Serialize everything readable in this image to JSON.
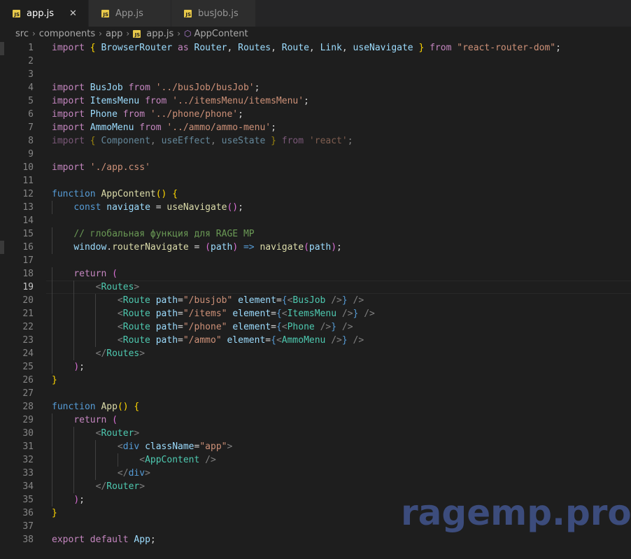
{
  "tabs": [
    {
      "label": "app.js",
      "icon": "js-file-icon",
      "active": true
    },
    {
      "label": "App.js",
      "icon": "js-file-icon",
      "active": false
    },
    {
      "label": "busJob.js",
      "icon": "js-file-icon",
      "active": false
    }
  ],
  "breadcrumb": [
    "src",
    "components",
    "app",
    "app.js",
    "AppContent"
  ],
  "current_line": 19,
  "code_lines": [
    {
      "n": 1,
      "t": [
        [
          "kw",
          "import"
        ],
        [
          "txt",
          " "
        ],
        [
          "br1",
          "{"
        ],
        [
          "vr",
          " BrowserRouter "
        ],
        [
          "kw",
          "as"
        ],
        [
          "vr",
          " Router"
        ],
        [
          "txt",
          ", "
        ],
        [
          "vr",
          "Routes"
        ],
        [
          "txt",
          ", "
        ],
        [
          "vr",
          "Route"
        ],
        [
          "txt",
          ", "
        ],
        [
          "vr",
          "Link"
        ],
        [
          "txt",
          ", "
        ],
        [
          "vr",
          "useNavigate"
        ],
        [
          "txt",
          " "
        ],
        [
          "br1",
          "}"
        ],
        [
          "txt",
          " "
        ],
        [
          "kw",
          "from"
        ],
        [
          "txt",
          " "
        ],
        [
          "sr",
          "\"react-router-dom\""
        ],
        [
          "txt",
          ";"
        ]
      ]
    },
    {
      "n": 2,
      "t": []
    },
    {
      "n": 3,
      "t": []
    },
    {
      "n": 4,
      "t": [
        [
          "kw",
          "import"
        ],
        [
          "vr",
          " BusJob "
        ],
        [
          "kw",
          "from"
        ],
        [
          "txt",
          " "
        ],
        [
          "sr",
          "'../busJob/busJob'"
        ],
        [
          "txt",
          ";"
        ]
      ]
    },
    {
      "n": 5,
      "t": [
        [
          "kw",
          "import"
        ],
        [
          "vr",
          " ItemsMenu "
        ],
        [
          "kw",
          "from"
        ],
        [
          "txt",
          " "
        ],
        [
          "sr",
          "'../itemsMenu/itemsMenu'"
        ],
        [
          "txt",
          ";"
        ]
      ]
    },
    {
      "n": 6,
      "t": [
        [
          "kw",
          "import"
        ],
        [
          "vr",
          " Phone "
        ],
        [
          "kw",
          "from"
        ],
        [
          "txt",
          " "
        ],
        [
          "sr",
          "'../phone/phone'"
        ],
        [
          "txt",
          ";"
        ]
      ]
    },
    {
      "n": 7,
      "t": [
        [
          "kw",
          "import"
        ],
        [
          "vr",
          " AmmoMenu "
        ],
        [
          "kw",
          "from"
        ],
        [
          "txt",
          " "
        ],
        [
          "sr",
          "'../ammo/ammo-menu'"
        ],
        [
          "txt",
          ";"
        ]
      ]
    },
    {
      "n": 8,
      "dim": true,
      "t": [
        [
          "kw",
          "import"
        ],
        [
          "txt",
          " "
        ],
        [
          "br1",
          "{"
        ],
        [
          "vr",
          " Component"
        ],
        [
          "txt",
          ", "
        ],
        [
          "vr",
          "useEffect"
        ],
        [
          "txt",
          ", "
        ],
        [
          "vr",
          "useState"
        ],
        [
          "txt",
          " "
        ],
        [
          "br1",
          "}"
        ],
        [
          "txt",
          " "
        ],
        [
          "kw",
          "from"
        ],
        [
          "txt",
          " "
        ],
        [
          "sr",
          "'react'"
        ],
        [
          "txt",
          ";"
        ]
      ]
    },
    {
      "n": 9,
      "t": []
    },
    {
      "n": 10,
      "t": [
        [
          "kw",
          "import"
        ],
        [
          "txt",
          " "
        ],
        [
          "sr",
          "'./app.css'"
        ]
      ]
    },
    {
      "n": 11,
      "t": []
    },
    {
      "n": 12,
      "t": [
        [
          "st",
          "function"
        ],
        [
          "txt",
          " "
        ],
        [
          "fn",
          "AppContent"
        ],
        [
          "br1",
          "()"
        ],
        [
          "txt",
          " "
        ],
        [
          "br1",
          "{"
        ]
      ]
    },
    {
      "n": 13,
      "t": [
        [
          "txt",
          "    "
        ],
        [
          "st",
          "const"
        ],
        [
          "txt",
          " "
        ],
        [
          "vr",
          "navigate"
        ],
        [
          "txt",
          " = "
        ],
        [
          "fn",
          "useNavigate"
        ],
        [
          "br2",
          "()"
        ],
        [
          "txt",
          ";"
        ]
      ]
    },
    {
      "n": 14,
      "t": []
    },
    {
      "n": 15,
      "t": [
        [
          "txt",
          "    "
        ],
        [
          "cm",
          "// глобальная функция для RAGE MP"
        ]
      ]
    },
    {
      "n": 16,
      "t": [
        [
          "txt",
          "    "
        ],
        [
          "vr",
          "window"
        ],
        [
          "txt",
          "."
        ],
        [
          "fn",
          "routerNavigate"
        ],
        [
          "txt",
          " = "
        ],
        [
          "br2",
          "("
        ],
        [
          "vr",
          "path"
        ],
        [
          "br2",
          ")"
        ],
        [
          "txt",
          " "
        ],
        [
          "st",
          "=>"
        ],
        [
          "txt",
          " "
        ],
        [
          "fn",
          "navigate"
        ],
        [
          "br2",
          "("
        ],
        [
          "vr",
          "path"
        ],
        [
          "br2",
          ")"
        ],
        [
          "txt",
          ";"
        ]
      ]
    },
    {
      "n": 17,
      "t": []
    },
    {
      "n": 18,
      "t": [
        [
          "txt",
          "    "
        ],
        [
          "kw",
          "return"
        ],
        [
          "txt",
          " "
        ],
        [
          "br2",
          "("
        ]
      ]
    },
    {
      "n": 19,
      "t": [
        [
          "txt",
          "        "
        ],
        [
          "pu",
          "<"
        ],
        [
          "tg",
          "Routes"
        ],
        [
          "pu",
          ">"
        ]
      ]
    },
    {
      "n": 20,
      "t": [
        [
          "txt",
          "            "
        ],
        [
          "pu",
          "<"
        ],
        [
          "tg",
          "Route"
        ],
        [
          "txt",
          " "
        ],
        [
          "at",
          "path"
        ],
        [
          "txt",
          "="
        ],
        [
          "sr",
          "\"/busjob\""
        ],
        [
          "txt",
          " "
        ],
        [
          "at",
          "element"
        ],
        [
          "txt",
          "="
        ],
        [
          "st",
          "{"
        ],
        [
          "pu",
          "<"
        ],
        [
          "tg",
          "BusJob"
        ],
        [
          "txt",
          " "
        ],
        [
          "pu",
          "/>"
        ],
        [
          "st",
          "}"
        ],
        [
          "txt",
          " "
        ],
        [
          "pu",
          "/>"
        ]
      ]
    },
    {
      "n": 21,
      "t": [
        [
          "txt",
          "            "
        ],
        [
          "pu",
          "<"
        ],
        [
          "tg",
          "Route"
        ],
        [
          "txt",
          " "
        ],
        [
          "at",
          "path"
        ],
        [
          "txt",
          "="
        ],
        [
          "sr",
          "\"/items\""
        ],
        [
          "txt",
          " "
        ],
        [
          "at",
          "element"
        ],
        [
          "txt",
          "="
        ],
        [
          "st",
          "{"
        ],
        [
          "pu",
          "<"
        ],
        [
          "tg",
          "ItemsMenu"
        ],
        [
          "txt",
          " "
        ],
        [
          "pu",
          "/>"
        ],
        [
          "st",
          "}"
        ],
        [
          "txt",
          " "
        ],
        [
          "pu",
          "/>"
        ]
      ]
    },
    {
      "n": 22,
      "t": [
        [
          "txt",
          "            "
        ],
        [
          "pu",
          "<"
        ],
        [
          "tg",
          "Route"
        ],
        [
          "txt",
          " "
        ],
        [
          "at",
          "path"
        ],
        [
          "txt",
          "="
        ],
        [
          "sr",
          "\"/phone\""
        ],
        [
          "txt",
          " "
        ],
        [
          "at",
          "element"
        ],
        [
          "txt",
          "="
        ],
        [
          "st",
          "{"
        ],
        [
          "pu",
          "<"
        ],
        [
          "tg",
          "Phone"
        ],
        [
          "txt",
          " "
        ],
        [
          "pu",
          "/>"
        ],
        [
          "st",
          "}"
        ],
        [
          "txt",
          " "
        ],
        [
          "pu",
          "/>"
        ]
      ]
    },
    {
      "n": 23,
      "t": [
        [
          "txt",
          "            "
        ],
        [
          "pu",
          "<"
        ],
        [
          "tg",
          "Route"
        ],
        [
          "txt",
          " "
        ],
        [
          "at",
          "path"
        ],
        [
          "txt",
          "="
        ],
        [
          "sr",
          "\"/ammo\""
        ],
        [
          "txt",
          " "
        ],
        [
          "at",
          "element"
        ],
        [
          "txt",
          "="
        ],
        [
          "st",
          "{"
        ],
        [
          "pu",
          "<"
        ],
        [
          "tg",
          "AmmoMenu"
        ],
        [
          "txt",
          " "
        ],
        [
          "pu",
          "/>"
        ],
        [
          "st",
          "}"
        ],
        [
          "txt",
          " "
        ],
        [
          "pu",
          "/>"
        ]
      ]
    },
    {
      "n": 24,
      "t": [
        [
          "txt",
          "        "
        ],
        [
          "pu",
          "</"
        ],
        [
          "tg",
          "Routes"
        ],
        [
          "pu",
          ">"
        ]
      ]
    },
    {
      "n": 25,
      "t": [
        [
          "txt",
          "    "
        ],
        [
          "br2",
          ")"
        ],
        [
          "txt",
          ";"
        ]
      ]
    },
    {
      "n": 26,
      "t": [
        [
          "br1",
          "}"
        ]
      ]
    },
    {
      "n": 27,
      "t": []
    },
    {
      "n": 28,
      "t": [
        [
          "st",
          "function"
        ],
        [
          "txt",
          " "
        ],
        [
          "fn",
          "App"
        ],
        [
          "br1",
          "()"
        ],
        [
          "txt",
          " "
        ],
        [
          "br1",
          "{"
        ]
      ]
    },
    {
      "n": 29,
      "t": [
        [
          "txt",
          "    "
        ],
        [
          "kw",
          "return"
        ],
        [
          "txt",
          " "
        ],
        [
          "br2",
          "("
        ]
      ]
    },
    {
      "n": 30,
      "t": [
        [
          "txt",
          "        "
        ],
        [
          "pu",
          "<"
        ],
        [
          "tg",
          "Router"
        ],
        [
          "pu",
          ">"
        ]
      ]
    },
    {
      "n": 31,
      "t": [
        [
          "txt",
          "            "
        ],
        [
          "pu",
          "<"
        ],
        [
          "st",
          "div"
        ],
        [
          "txt",
          " "
        ],
        [
          "at",
          "className"
        ],
        [
          "txt",
          "="
        ],
        [
          "sr",
          "\"app\""
        ],
        [
          "pu",
          ">"
        ]
      ]
    },
    {
      "n": 32,
      "t": [
        [
          "txt",
          "                "
        ],
        [
          "pu",
          "<"
        ],
        [
          "tg",
          "AppContent"
        ],
        [
          "txt",
          " "
        ],
        [
          "pu",
          "/>"
        ]
      ]
    },
    {
      "n": 33,
      "t": [
        [
          "txt",
          "            "
        ],
        [
          "pu",
          "</"
        ],
        [
          "st",
          "div"
        ],
        [
          "pu",
          ">"
        ]
      ]
    },
    {
      "n": 34,
      "t": [
        [
          "txt",
          "        "
        ],
        [
          "pu",
          "</"
        ],
        [
          "tg",
          "Router"
        ],
        [
          "pu",
          ">"
        ]
      ]
    },
    {
      "n": 35,
      "t": [
        [
          "txt",
          "    "
        ],
        [
          "br2",
          ")"
        ],
        [
          "txt",
          ";"
        ]
      ]
    },
    {
      "n": 36,
      "t": [
        [
          "br1",
          "}"
        ]
      ]
    },
    {
      "n": 37,
      "t": []
    },
    {
      "n": 38,
      "t": [
        [
          "kw",
          "export"
        ],
        [
          "txt",
          " "
        ],
        [
          "kw",
          "default"
        ],
        [
          "txt",
          " "
        ],
        [
          "vr",
          "App"
        ],
        [
          "txt",
          ";"
        ]
      ]
    }
  ],
  "watermark": "ragemp.pro",
  "colors": {
    "keyword": "#c586c0",
    "storage": "#569cd6",
    "function": "#dcdcaa",
    "variable": "#9cdcfe",
    "string": "#ce9178",
    "comment": "#6a9955",
    "tag": "#4ec9b0"
  }
}
